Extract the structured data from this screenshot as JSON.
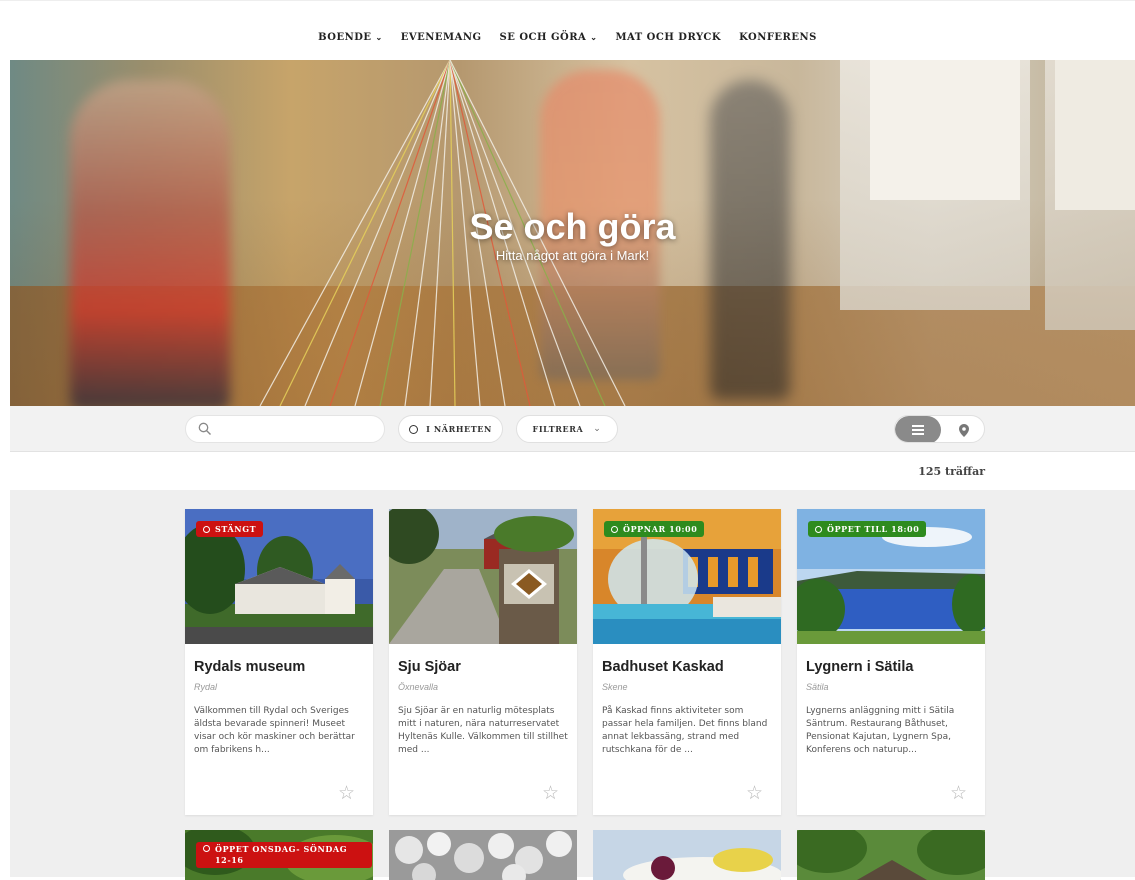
{
  "nav": {
    "items": [
      {
        "label": "BOENDE",
        "has_dropdown": true
      },
      {
        "label": "EVENEMANG",
        "has_dropdown": false
      },
      {
        "label": "SE OCH GÖRA",
        "has_dropdown": true
      },
      {
        "label": "MAT OCH DRYCK",
        "has_dropdown": false
      },
      {
        "label": "KONFERENS",
        "has_dropdown": false
      }
    ],
    "chevron": "⌄"
  },
  "hero": {
    "title": "Se och göra",
    "subtitle": "Hitta något att göra i Mark!"
  },
  "filters": {
    "search_placeholder": "",
    "search_icon": "search-icon",
    "near_label": "I NÄRHETEN",
    "filter_label": "FILTRERA",
    "view_list_icon": "list-icon",
    "view_map_icon": "map-pin-icon"
  },
  "results": {
    "count_text": "125 träffar"
  },
  "colors": {
    "closed": "#cc1111",
    "open": "#2e8b1e",
    "filter_bg": "#f2f2f2",
    "grid_bg": "#efefef",
    "toggle_active": "#8a8a8a"
  },
  "cards": [
    {
      "badge": "STÄNGT",
      "badge_status": "closed",
      "title": "Rydals museum",
      "place": "Rydal",
      "description": "Välkommen till Rydal och Sveriges äldsta bevarade spinneri! Museet visar och kör maskiner och berättar om fabrikens h..."
    },
    {
      "badge": "",
      "badge_status": "none",
      "title": "Sju Sjöar",
      "place": "Öxnevalla",
      "description": "Sju Sjöar är en naturlig mötesplats mitt i naturen, nära naturreservatet Hyltenäs Kulle. Välkommen till stillhet med ..."
    },
    {
      "badge": "ÖPPNAR 10:00",
      "badge_status": "open",
      "title": "Badhuset Kaskad",
      "place": "Skene",
      "description": "På Kaskad finns aktiviteter som passar hela familjen. Det finns bland annat lekbassäng, strand med rutschkana för de ..."
    },
    {
      "badge": "ÖPPET TILL 18:00",
      "badge_status": "open",
      "title": "Lygnern i Sätila",
      "place": "Sätila",
      "description": "Lygnerns anläggning mitt i Sätila Säntrum. Restaurang Båthuset, Pensionat Kajutan, Lygnern Spa, Konferens och naturup..."
    }
  ],
  "second_row": [
    {
      "badge": "ÖPPET ONSDAG- SÖNDAG 12-16",
      "badge_status": "closed"
    },
    {
      "badge": "",
      "badge_status": "none"
    },
    {
      "badge": "",
      "badge_status": "none"
    },
    {
      "badge": "",
      "badge_status": "none"
    }
  ],
  "star_glyph": "☆"
}
